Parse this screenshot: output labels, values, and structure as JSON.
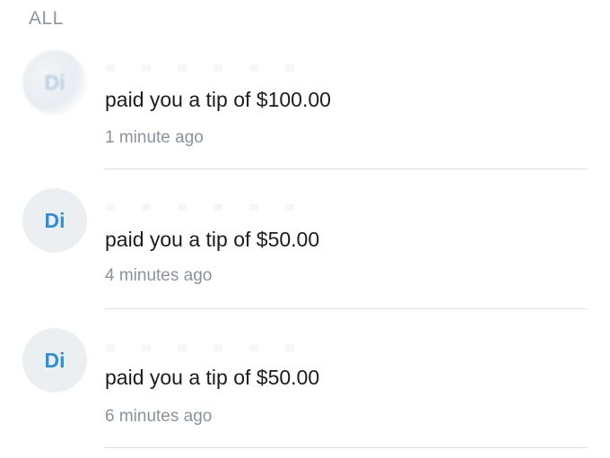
{
  "section": {
    "title": "ALL"
  },
  "notifications": [
    {
      "avatar_initials": "Di",
      "message": "paid you a tip of $100.00",
      "time": "1 minute ago"
    },
    {
      "avatar_initials": "Di",
      "message": "paid you a tip of $50.00",
      "time": "4 minutes ago"
    },
    {
      "avatar_initials": "Di",
      "message": "paid you a tip of $50.00",
      "time": "6 minutes ago"
    }
  ],
  "colors": {
    "avatar_text": "#2d8fd5",
    "avatar_bg": "#eceff2",
    "muted_text": "#8a929b",
    "divider": "#dde1e5"
  }
}
